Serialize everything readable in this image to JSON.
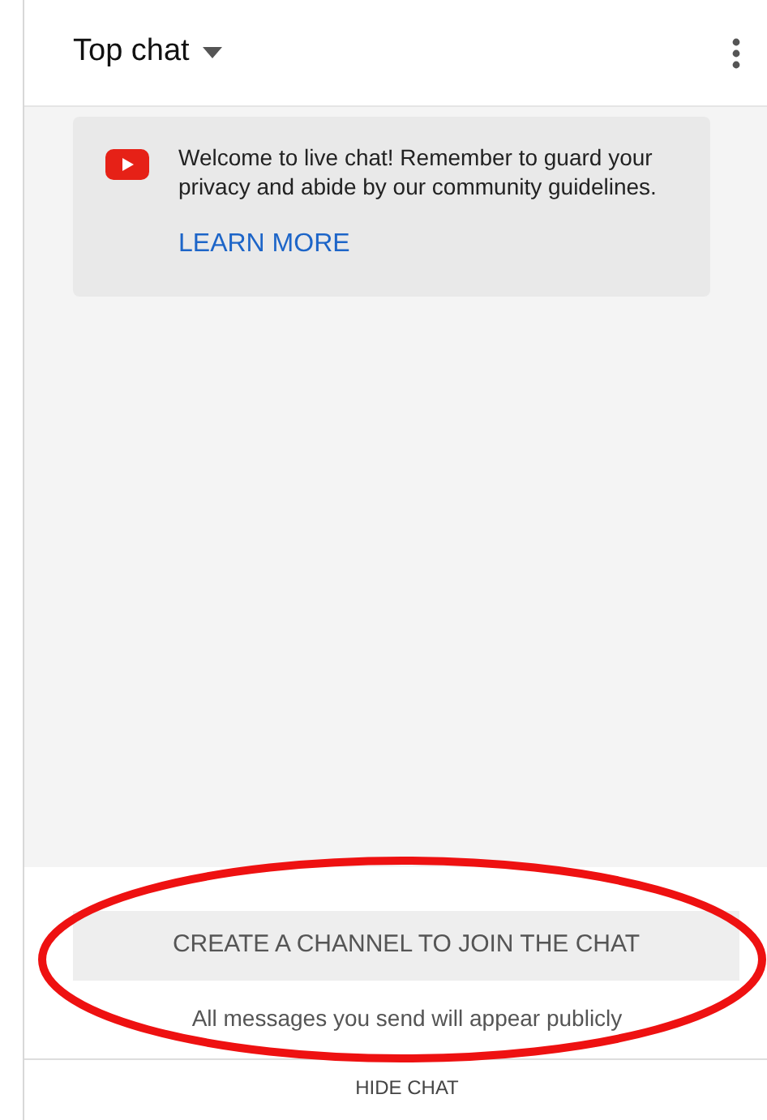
{
  "header": {
    "title": "Top chat"
  },
  "welcome": {
    "message": "Welcome to live chat! Remember to guard your privacy and abide by our community guidelines.",
    "link": "LEARN MORE"
  },
  "join_button": "CREATE A CHANNEL TO JOIN THE CHAT",
  "notice": "All messages you send will appear publicly",
  "hide_chat": "HIDE CHAT"
}
